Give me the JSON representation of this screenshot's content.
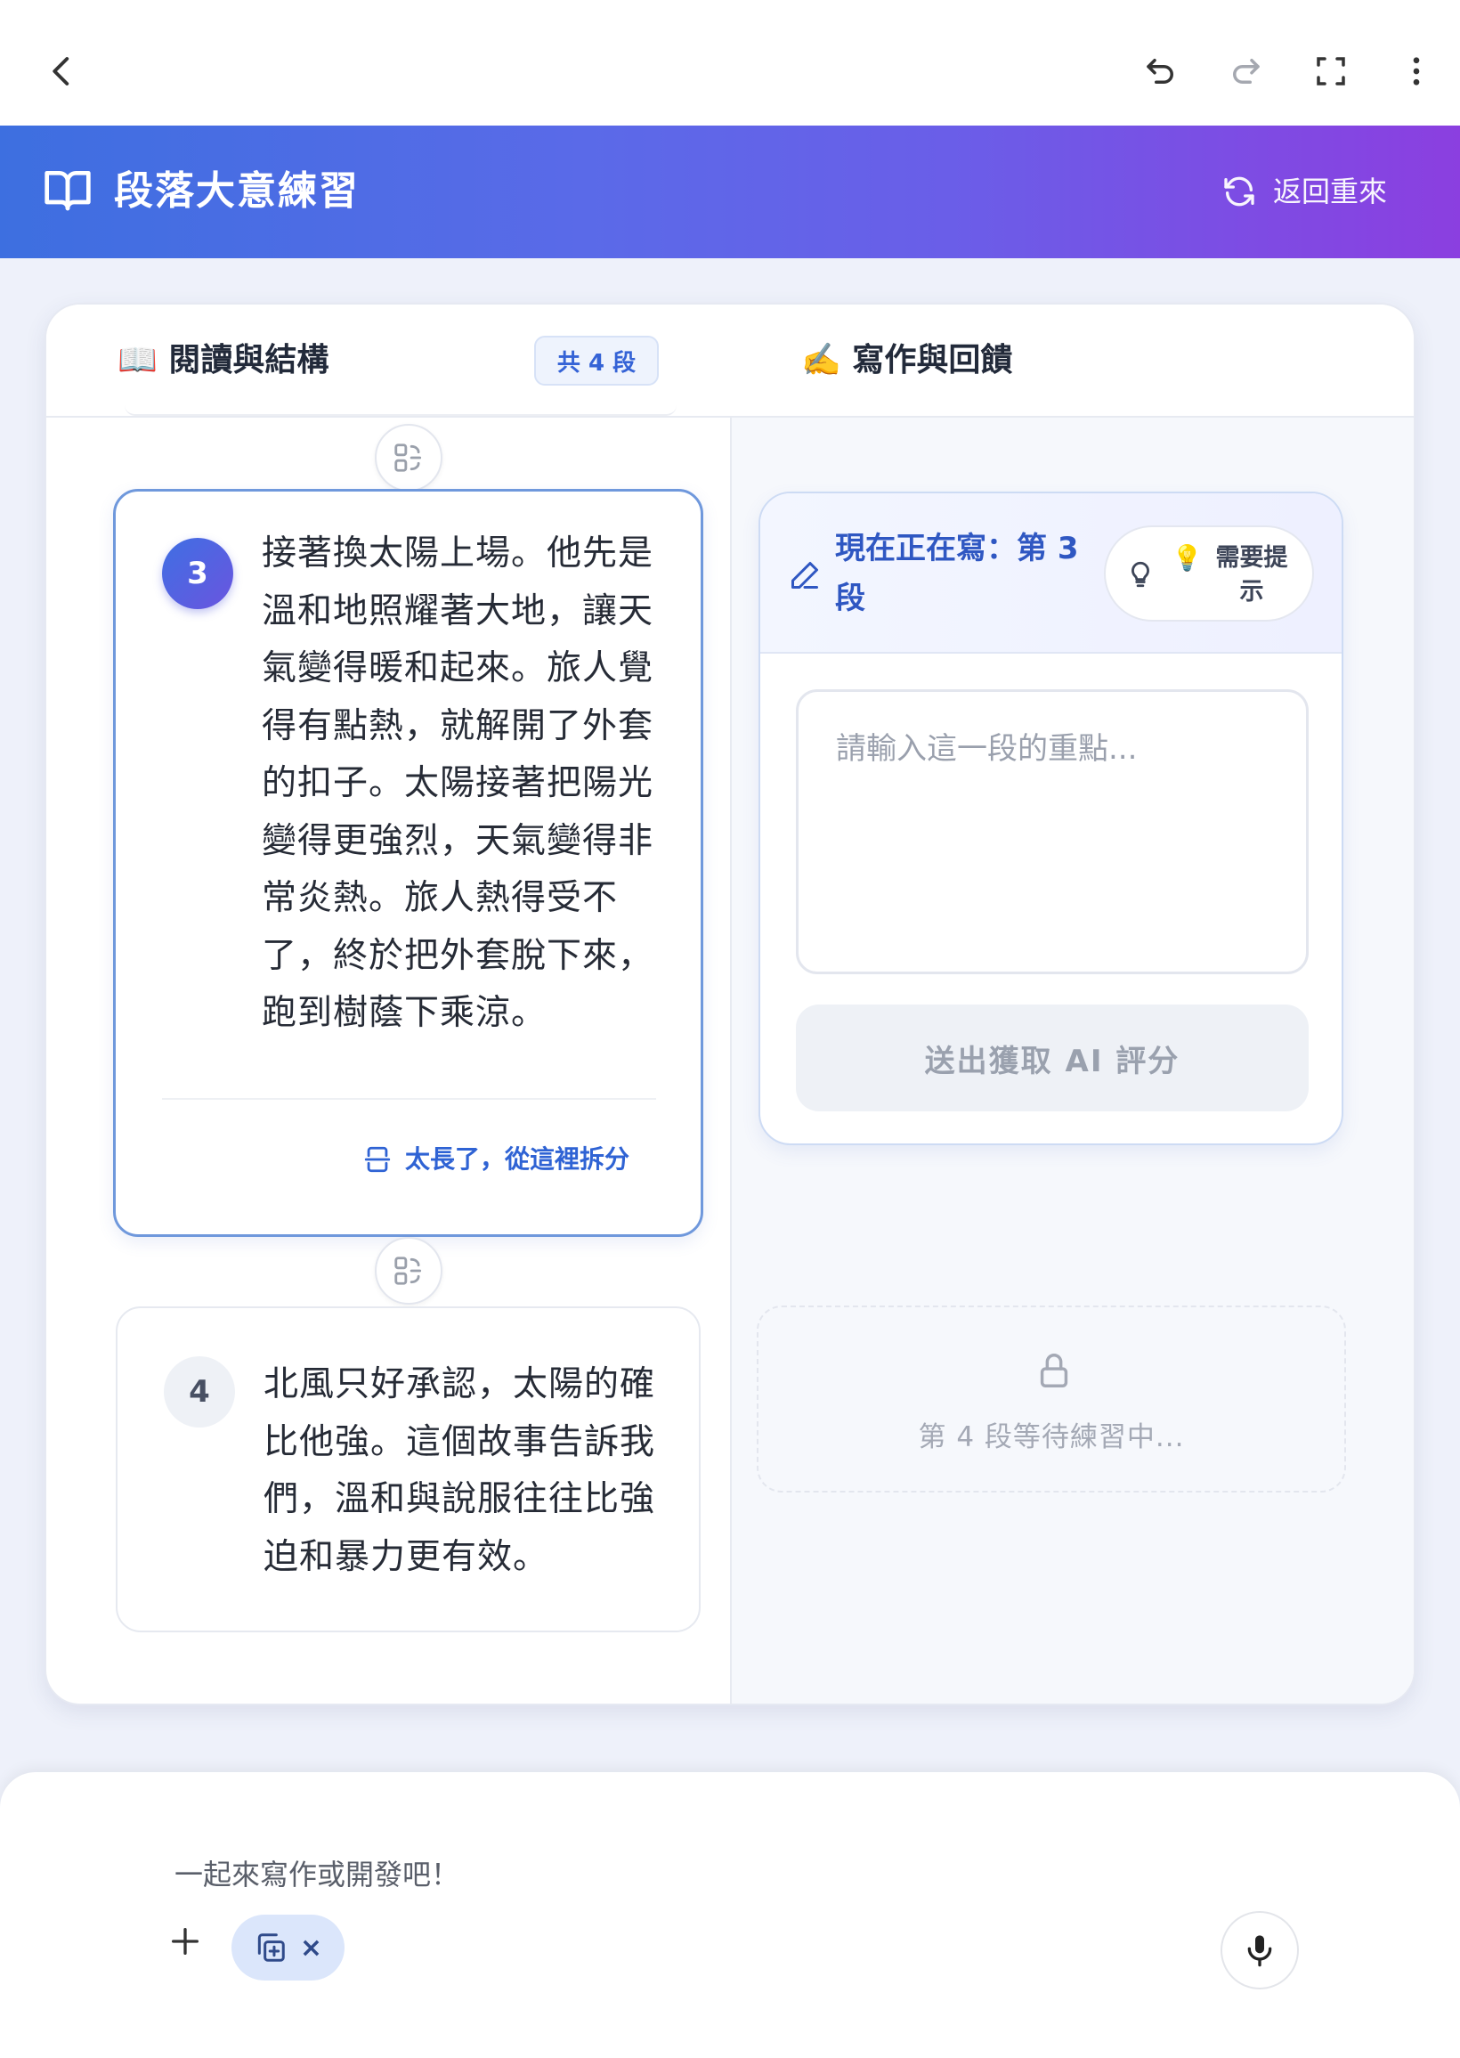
{
  "toolbar": {
    "back_icon": "chevron-left-icon",
    "undo_icon": "undo-icon",
    "redo_icon": "redo-icon",
    "fullscreen_icon": "fullscreen-icon",
    "more_icon": "more-vertical-icon"
  },
  "header": {
    "icon": "book-open-icon",
    "title": "段落大意練習",
    "restart_label": "返回重來",
    "restart_icon": "refresh-icon",
    "gradient_start": "#3d6fe0",
    "gradient_end": "#8b3fe0"
  },
  "left_panel": {
    "title": "📖 閱讀與結構",
    "count_badge": "共 4 段"
  },
  "right_panel": {
    "title": "✍️ 寫作與回饋"
  },
  "paragraphs": [
    {
      "number": "3",
      "text": "接著換太陽上場。他先是溫和地照耀著大地，讓天氣變得暖和起來。旅人覺得有點熱，就解開了外套的扣子。太陽接著把陽光變得更強烈，天氣變得非常炎熱。旅人熱得受不了，終於把外套脫下來，跑到樹蔭下乘涼。",
      "state": "active",
      "split_label": "太長了，從這裡拆分"
    },
    {
      "number": "4",
      "text": "北風只好承認，太陽的確比他強。這個故事告訴我們，溫和與說服往往比強迫和暴力更有效。",
      "state": "idle"
    }
  ],
  "writing": {
    "current_title": "現在正在寫：第 3 段",
    "hint_emoji": "💡",
    "hint_label": "需要提示",
    "input_value": "",
    "input_placeholder": "請輸入這一段的重點...",
    "submit_label": "送出獲取 AI 評分",
    "locked_text": "第 4 段等待練習中..."
  },
  "chat": {
    "placeholder": "一起來寫作或開發吧！",
    "chip_close": "×"
  },
  "colors": {
    "accent": "#3563d6",
    "active_border": "#6f98dc",
    "background": "#eef1fa"
  }
}
